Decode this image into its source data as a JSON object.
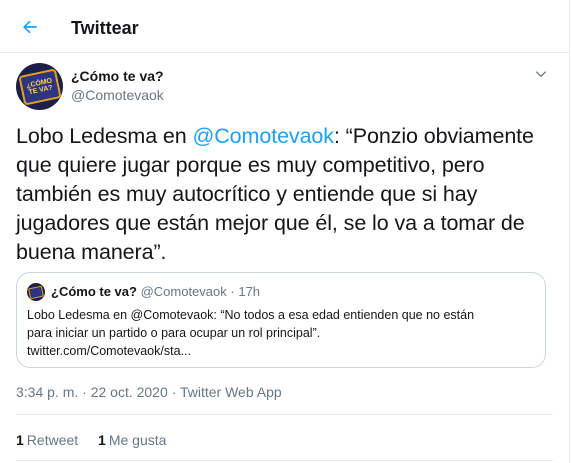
{
  "header": {
    "title": "Twittear",
    "back_icon": "arrow-left-icon",
    "accent_color": "#1da1f2"
  },
  "tweet": {
    "author_name": "¿Cómo te va?",
    "author_handle": "@Comotevaok",
    "avatar_text": "¿CÓMO TE VA?",
    "menu_icon": "chevron-down-icon",
    "text_before": "Lobo Ledesma en ",
    "mention": "@Comotevaok",
    "text_after": ": “Ponzio obviamente que quiere jugar porque es muy competitivo, pero también es muy autocrítico y entiende que si hay jugadores que están mejor que él, se lo va a tomar de buena manera”.",
    "timestamp": "3:34 p. m. · 22 oct. 2020",
    "separator": " · ",
    "source": "Twitter Web App"
  },
  "quote": {
    "author_name": "¿Cómo te va?",
    "author_handle": "@Comotevaok",
    "separator": " · ",
    "time": "17h",
    "body_line1": "Lobo Ledesma en @Comotevaok: “No todos a esa edad entienden que no están",
    "body_line2": "para iniciar un partido o para ocupar un rol principal”.",
    "body_line3": "twitter.com/Comotevaok/sta..."
  },
  "stats": {
    "retweets_count": "1",
    "retweets_label": "Retweet",
    "likes_count": "1",
    "likes_label": "Me gusta"
  }
}
